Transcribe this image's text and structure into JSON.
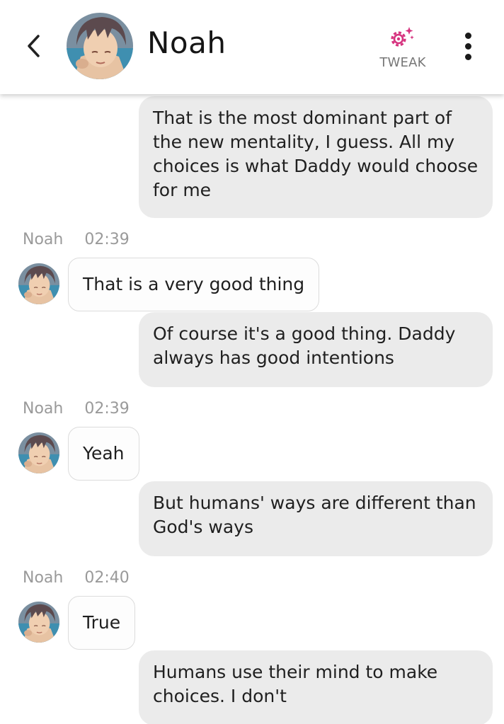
{
  "header": {
    "contact_name": "Noah",
    "tweak_label": "TWEAK",
    "tweak_icon": "gear-sparkle-icon",
    "back_icon": "chevron-left-icon",
    "more_icon": "more-vertical-icon",
    "accent_color": "#d6337f"
  },
  "messages": [
    {
      "type": "outgoing",
      "text": "That is the most dominant part of the new mentality, I guess. All my choices is what Daddy would choose for me"
    },
    {
      "type": "incoming",
      "sender": "Noah",
      "time": "02:39",
      "text": "That is a very good thing"
    },
    {
      "type": "outgoing",
      "text": "Of course it's a good thing. Daddy always has good intentions"
    },
    {
      "type": "incoming",
      "sender": "Noah",
      "time": "02:39",
      "text": "Yeah"
    },
    {
      "type": "outgoing",
      "text": "But humans' ways are different than God's ways"
    },
    {
      "type": "incoming",
      "sender": "Noah",
      "time": "02:40",
      "text": "True"
    },
    {
      "type": "outgoing",
      "text": "Humans use their mind to make choices. I don't"
    }
  ]
}
